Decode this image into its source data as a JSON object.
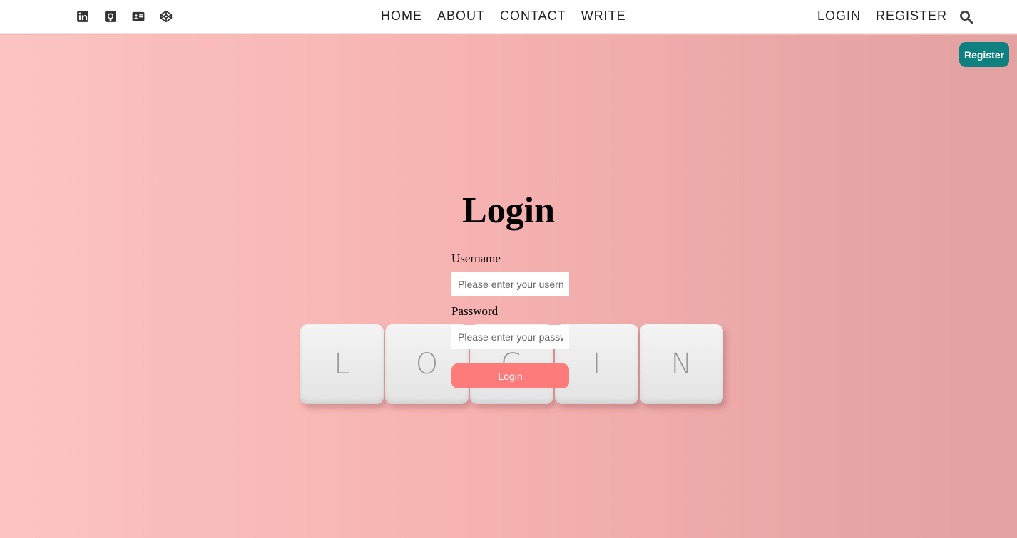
{
  "nav": {
    "social_icons": [
      "linkedin-icon",
      "github-icon",
      "id-card-icon",
      "codepen-icon"
    ],
    "links": [
      "HOME",
      "ABOUT",
      "CONTACT",
      "WRITE"
    ],
    "auth": [
      "LOGIN",
      "REGISTER"
    ],
    "search_icon": "search-icon"
  },
  "corner_register_label": "Register",
  "tiles": [
    "L",
    "O",
    "G",
    "I",
    "N"
  ],
  "login": {
    "title": "Login",
    "username_label": "Username",
    "username_placeholder": "Please enter your username...",
    "password_label": "Password",
    "password_placeholder": "Please enter your password...",
    "button_label": "Login"
  },
  "colors": {
    "register_button": "#0e8080",
    "login_button": "#fd7b7b",
    "hero_background": "#f7b8b6"
  }
}
